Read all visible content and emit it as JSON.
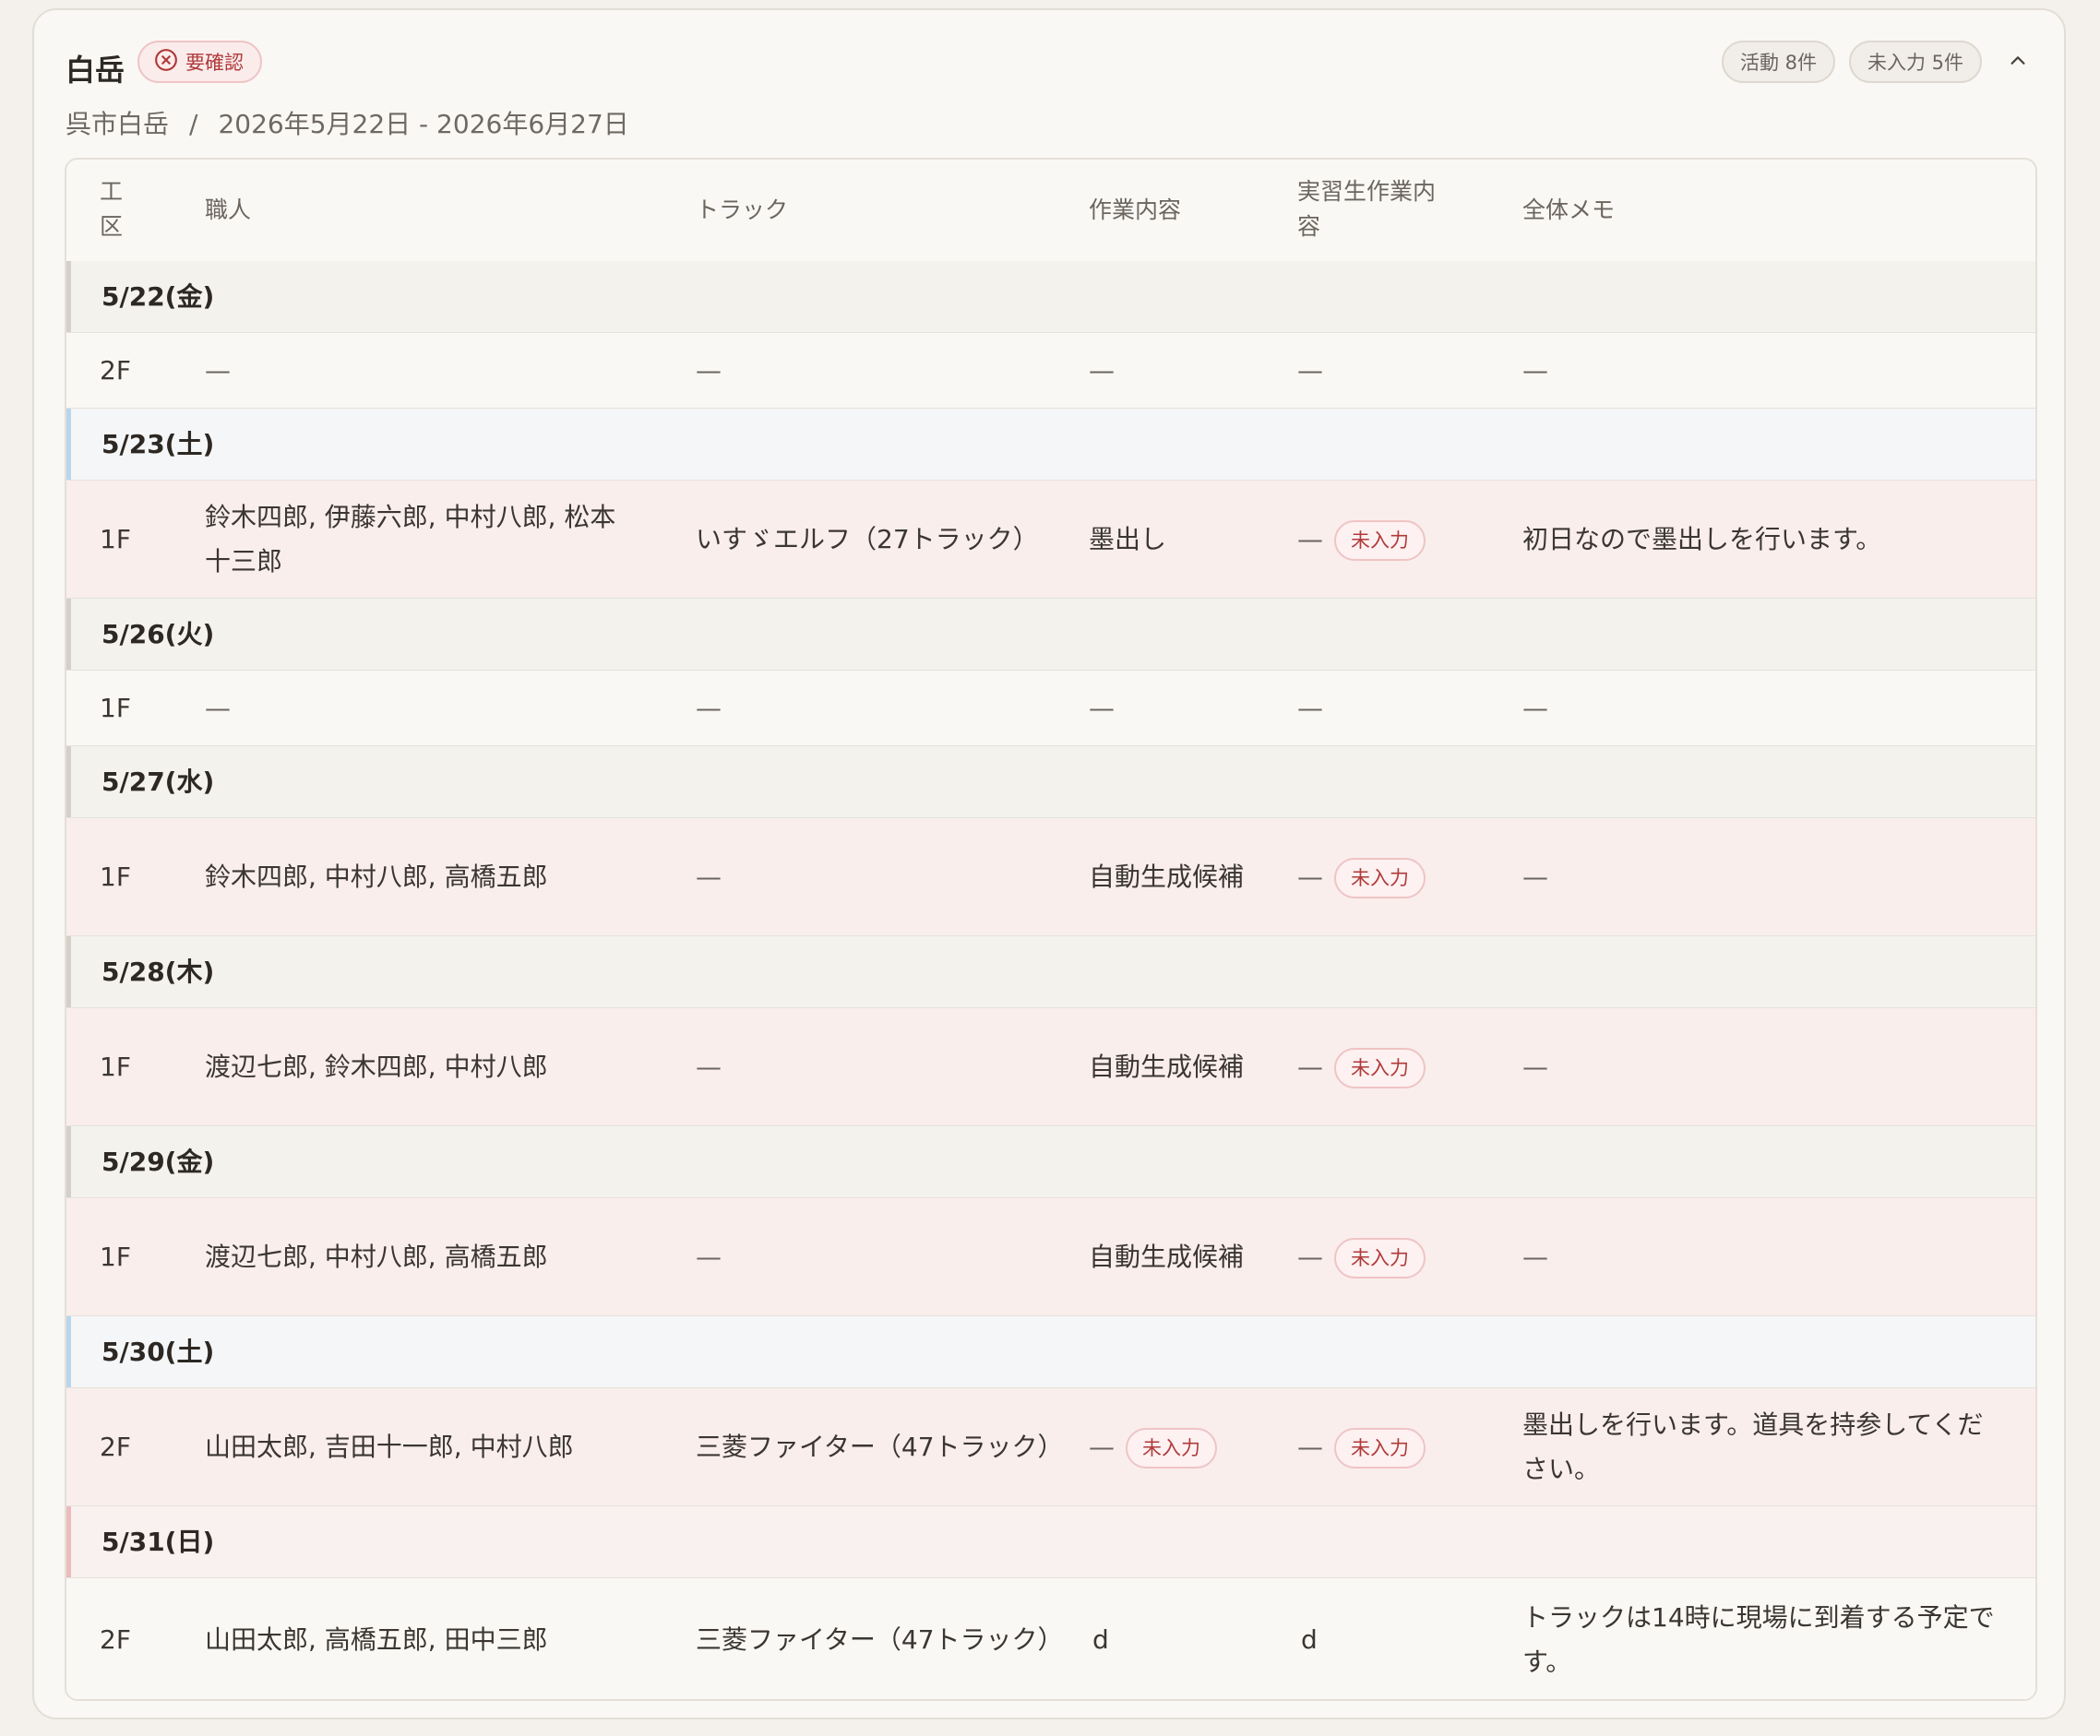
{
  "card": {
    "title": "白岳",
    "status_badge": "要確認",
    "location": "呉市白岳",
    "separator": "/",
    "date_range": "2026年5月22日 - 2026年6月27日",
    "pill_activity": "活動 8件",
    "pill_missing": "未入力 5件"
  },
  "table": {
    "headers": {
      "area_line1": "工",
      "area_line2": "区",
      "worker": "職人",
      "truck": "トラック",
      "work": "作業内容",
      "trainee_line1": "実習生作業内",
      "trainee_line2": "容",
      "memo": "全体メモ"
    },
    "missing_tag": "未入力",
    "dash": "—",
    "groups": [
      {
        "date": "5/22(金)",
        "row": {
          "area": "2F",
          "worker": "—",
          "truck": "—",
          "work": "—",
          "trainee": "—",
          "memo": "—"
        }
      },
      {
        "date": "5/23(土)",
        "row": {
          "area": "1F",
          "worker": "鈴木四郎, 伊藤六郎, 中村八郎, 松本十三郎",
          "truck": "いすゞエルフ（27トラック）",
          "work": "墨出し",
          "trainee": "—",
          "memo": "初日なので墨出しを行います。"
        }
      },
      {
        "date": "5/26(火)",
        "row": {
          "area": "1F",
          "worker": "—",
          "truck": "—",
          "work": "—",
          "trainee": "—",
          "memo": "—"
        }
      },
      {
        "date": "5/27(水)",
        "row": {
          "area": "1F",
          "worker": "鈴木四郎, 中村八郎, 高橋五郎",
          "truck": "—",
          "work": "自動生成候補",
          "trainee": "—",
          "memo": "—"
        }
      },
      {
        "date": "5/28(木)",
        "row": {
          "area": "1F",
          "worker": "渡辺七郎, 鈴木四郎, 中村八郎",
          "truck": "—",
          "work": "自動生成候補",
          "trainee": "—",
          "memo": "—"
        }
      },
      {
        "date": "5/29(金)",
        "row": {
          "area": "1F",
          "worker": "渡辺七郎, 中村八郎, 高橋五郎",
          "truck": "—",
          "work": "自動生成候補",
          "trainee": "—",
          "memo": "—"
        }
      },
      {
        "date": "5/30(土)",
        "row": {
          "area": "2F",
          "worker": "山田太郎, 吉田十一郎, 中村八郎",
          "truck": "三菱ファイター（47トラック）",
          "work": "—",
          "trainee": "—",
          "memo": "墨出しを行います。道具を持参してください。"
        }
      },
      {
        "date": "5/31(日)",
        "row": {
          "area": "2F",
          "worker": "山田太郎, 高橋五郎, 田中三郎",
          "truck": "三菱ファイター（47トラック）",
          "work": "d",
          "trainee": "d",
          "memo": "トラックは14時に現場に到着する予定です。"
        }
      }
    ]
  }
}
